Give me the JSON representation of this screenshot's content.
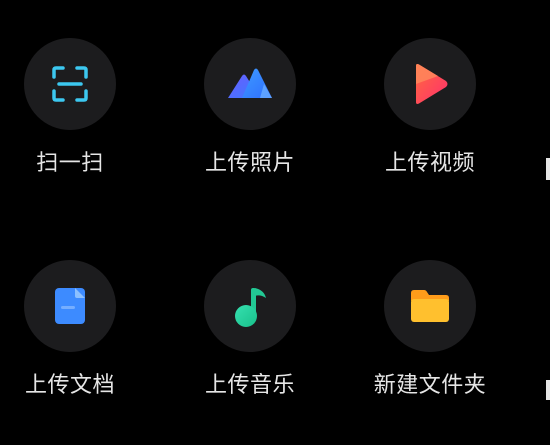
{
  "actions": {
    "scan": {
      "label": "扫一扫",
      "icon": "scan-icon",
      "color": "#3cc8f0"
    },
    "upload_photo": {
      "label": "上传照片",
      "icon": "photo-mountain-icon",
      "color": "#4a7cff"
    },
    "upload_video": {
      "label": "上传视频",
      "icon": "video-play-icon",
      "color": "#ff3d5c"
    },
    "upload_document": {
      "label": "上传文档",
      "icon": "document-icon",
      "color": "#3d8bff"
    },
    "upload_music": {
      "label": "上传音乐",
      "icon": "music-note-icon",
      "color": "#2ed6a0"
    },
    "new_folder": {
      "label": "新建文件夹",
      "icon": "folder-icon",
      "color": "#ffb020"
    }
  }
}
